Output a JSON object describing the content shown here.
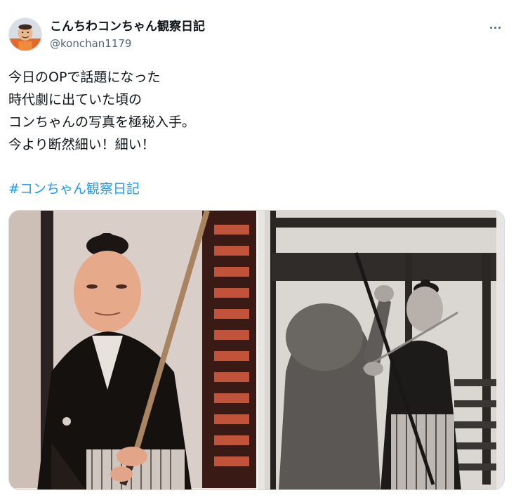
{
  "author": {
    "display_name": "こんちわコンちゃん観察日記",
    "handle": "@konchan1179",
    "avatar_icon": "avatar-photo"
  },
  "menu": {
    "icon": "more-horizontal-icon"
  },
  "tweet": {
    "lines": [
      "今日のOPで話題になった",
      "時代劇に出ていた頃の",
      "コンちゃんの写真を極秘入手。",
      "今より断然細い！細い！"
    ],
    "hashtag": "#コンちゃん観察日記"
  },
  "media": {
    "photos": [
      {
        "name": "photo-left",
        "depicts": "color photo of samurai actor holding sword"
      },
      {
        "name": "photo-right",
        "depicts": "black and white photo of sword fight scene"
      }
    ]
  },
  "colors": {
    "text": "#0f1419",
    "secondary": "#536471",
    "link": "#1d9bf0",
    "border": "#cfd9de"
  }
}
